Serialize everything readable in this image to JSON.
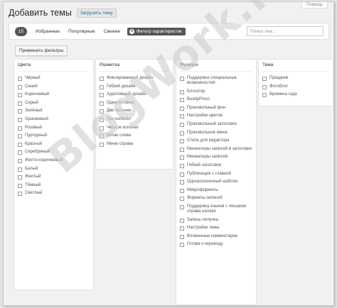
{
  "header": {
    "title": "Добавить темы",
    "upload_label": "Загрузить тему",
    "help_label": "Помощь"
  },
  "filterbar": {
    "count": "15",
    "tabs": [
      "Избранные",
      "Популярные",
      "Свежие"
    ],
    "feature_filter_label": "Фильтр характеристик",
    "search_placeholder": "Поиск тем..."
  },
  "apply_filters_label": "Применить фильтры",
  "groups": {
    "colors": {
      "title": "Цвета",
      "items": [
        "Чёрный",
        "Синий",
        "Коричневый",
        "Серый",
        "Зелёный",
        "Оранжевый",
        "Розовый",
        "Пурпурный",
        "Красный",
        "Серебряный",
        "Желто-коричневый",
        "Белый",
        "Желтый",
        "Тёмный",
        "Светлый"
      ]
    },
    "layout": {
      "title": "Разметка",
      "items": [
        "Фиксированный дизайн",
        "Гибкий дизайн",
        "Адаптивный дизайн",
        "Одна колонка",
        "Две колонки",
        "Три колонки",
        "Четыре колонки",
        "Меню слева",
        "Меню справа"
      ]
    },
    "features": {
      "title": "Функции",
      "items": [
        "Поддержка специальных возможностей",
        "Блогатор",
        "BuddyPress",
        "Произвольный фон",
        "Настройки цветов",
        "Произвольный заголовок",
        "Произвольное меню",
        "Стиль для редактора",
        "Миниатюры записей в заголовке",
        "Миниатюры записей",
        "Гибкий заголовок",
        "Публикация с главной",
        "Одноколоночный шаблон",
        "Микроформаты",
        "Форматы записей",
        "Поддержка языков с письмом справа налево",
        "Запись-липучка",
        "Настройки темы",
        "Вложенные комментарии",
        "Готова к переводу"
      ]
    },
    "subject": {
      "title": "Тема",
      "items": [
        "Праздник",
        "Фотоблог",
        "Времена года"
      ]
    }
  },
  "watermark": "BlogWork.RU"
}
